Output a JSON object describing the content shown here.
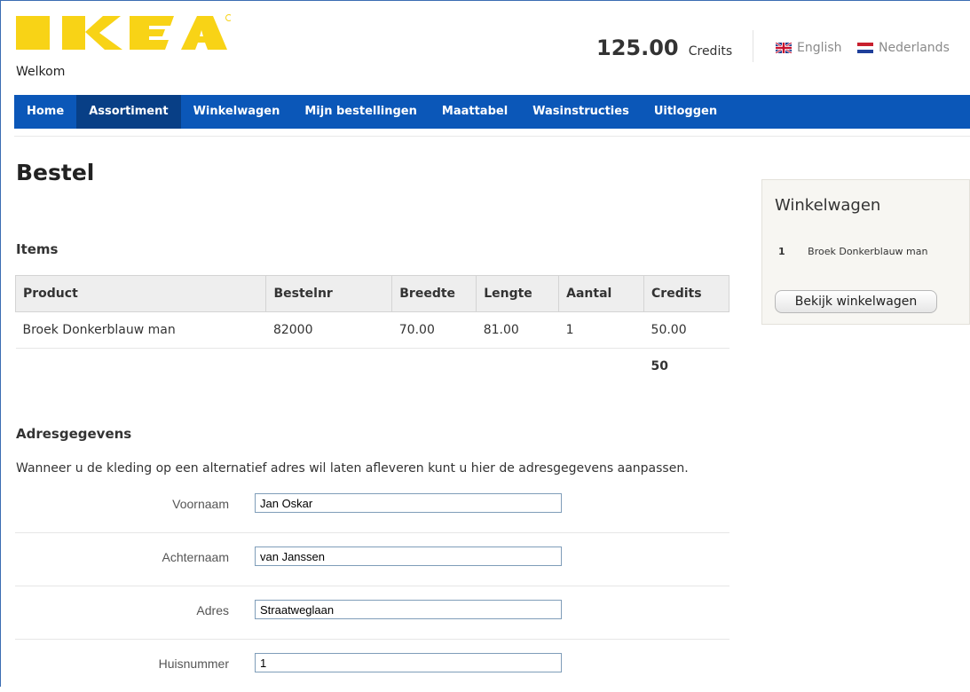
{
  "header": {
    "brand": "IKEA",
    "welcome": "Welkom",
    "credits_amount": "125.00",
    "credits_label": "Credits",
    "languages": [
      {
        "label": "English",
        "icon": "uk-flag-icon"
      },
      {
        "label": "Nederlands",
        "icon": "nl-flag-icon"
      }
    ]
  },
  "nav": {
    "items": [
      {
        "label": "Home",
        "active": false
      },
      {
        "label": "Assortiment",
        "active": true
      },
      {
        "label": "Winkelwagen",
        "active": false
      },
      {
        "label": "Mijn bestellingen",
        "active": false
      },
      {
        "label": "Maattabel",
        "active": false
      },
      {
        "label": "Wasinstructies",
        "active": false
      },
      {
        "label": "Uitloggen",
        "active": false
      }
    ]
  },
  "page": {
    "title": "Bestel",
    "items_title": "Items",
    "items_table": {
      "headers": [
        "Product",
        "Bestelnr",
        "Breedte",
        "Lengte",
        "Aantal",
        "Credits"
      ],
      "rows": [
        [
          "Broek Donkerblauw man",
          "82000",
          "70.00",
          "81.00",
          "1",
          "50.00"
        ]
      ],
      "total": "50"
    },
    "address_title": "Adresgegevens",
    "address_description": "Wanneer u de kleding op een alternatief adres wil laten afleveren kunt u hier de adresgegevens aanpassen.",
    "address_fields": [
      {
        "label": "Voornaam",
        "value": "Jan Oskar"
      },
      {
        "label": "Achternaam",
        "value": "van Janssen"
      },
      {
        "label": "Adres",
        "value": "Straatweglaan"
      },
      {
        "label": "Huisnummer",
        "value": "1"
      }
    ]
  },
  "cart": {
    "title": "Winkelwagen",
    "items": [
      {
        "qty": "1",
        "name": "Broek Donkerblauw man"
      }
    ],
    "button_label": "Bekijk winkelwagen"
  },
  "colors": {
    "brand_yellow": "#f8d316",
    "nav_blue": "#0b57b8",
    "nav_active": "#083f86"
  }
}
